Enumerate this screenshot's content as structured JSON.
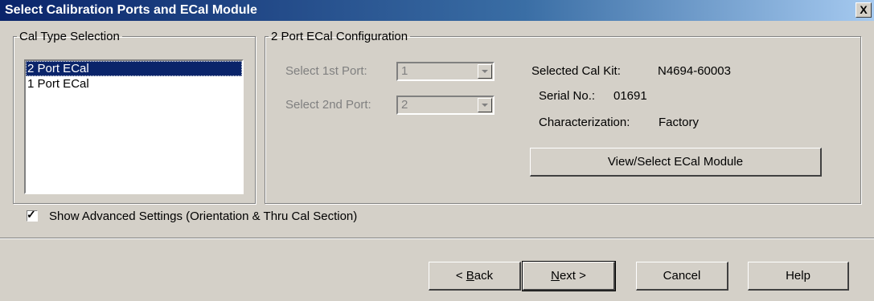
{
  "window": {
    "title": "Select Calibration Ports and ECal Module",
    "close_label": "X"
  },
  "cal_type": {
    "legend": "Cal Type Selection",
    "items": [
      "2 Port ECal",
      "1 Port ECal"
    ],
    "selected_index": 0
  },
  "config": {
    "legend": "2 Port ECal Configuration",
    "port1_label": "Select 1st Port:",
    "port1_value": "1",
    "port2_label": "Select 2nd Port:",
    "port2_value": "2",
    "selected_kit_label": "Selected Cal Kit:",
    "selected_kit_value": "N4694-60003",
    "serial_label": "Serial No.:",
    "serial_value": "01691",
    "characterization_label": "Characterization:",
    "characterization_value": "Factory",
    "view_select_label": "View/Select ECal Module"
  },
  "advanced": {
    "checked": true,
    "label": "Show Advanced Settings (Orientation & Thru Cal Section)"
  },
  "footer": {
    "back_prefix": "< ",
    "back_mnemonic": "B",
    "back_rest": "ack",
    "next_mnemonic": "N",
    "next_rest": "ext >",
    "cancel_label": "Cancel",
    "help_label": "Help"
  }
}
